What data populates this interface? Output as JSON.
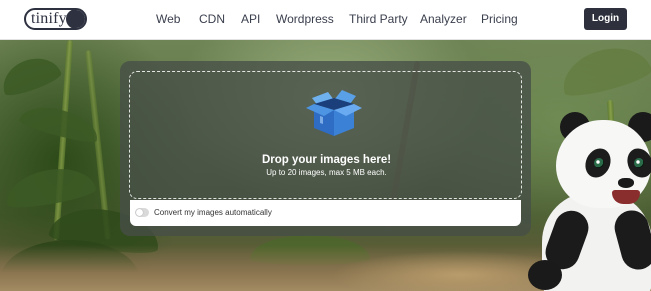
{
  "brand": {
    "logo_text": "tinify"
  },
  "nav": {
    "links": [
      "Web",
      "CDN",
      "API",
      "Wordpress",
      "Third Party",
      "Analyzer",
      "Pricing"
    ],
    "login_label": "Login"
  },
  "upload": {
    "title": "Drop your images here!",
    "subtitle": "Up to 20 images, max 5 MB each.",
    "auto_convert_label": "Convert my images automatically",
    "auto_convert_enabled": false
  },
  "colors": {
    "header_bg": "#ffffff",
    "nav_text": "#3a3f4d",
    "login_bg": "#2e313d",
    "box_icon_blue": "#3a7fd0"
  },
  "icons": {
    "upload": "open-box-icon",
    "toggle": "toggle-switch"
  }
}
